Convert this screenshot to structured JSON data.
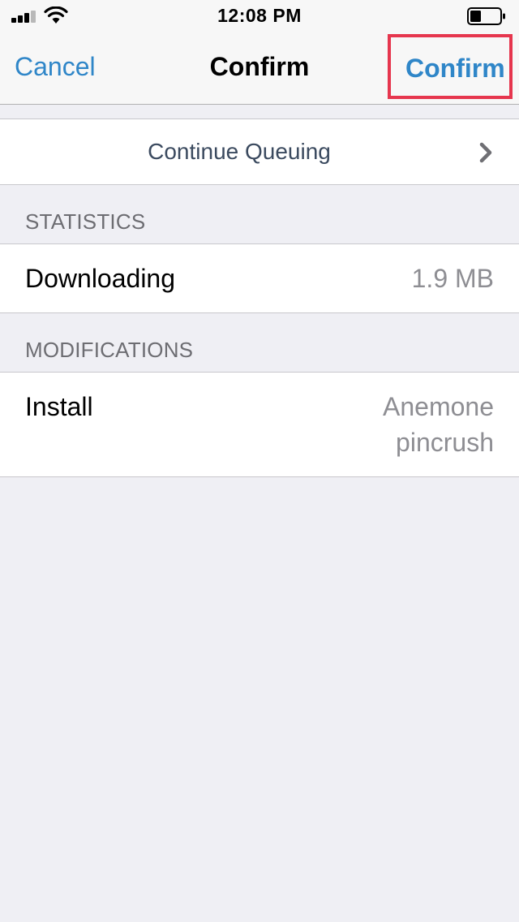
{
  "status_bar": {
    "time": "12:08 PM"
  },
  "nav": {
    "cancel_label": "Cancel",
    "title": "Confirm",
    "confirm_label": "Confirm",
    "accent_color": "#2f86c8",
    "highlight_color": "#e6364e"
  },
  "queue": {
    "label": "Continue Queuing",
    "icon": "chevron-right-icon"
  },
  "statistics": {
    "header": "STATISTICS",
    "row_label": "Downloading",
    "row_value": "1.9 MB"
  },
  "modifications": {
    "header": "MODIFICATIONS",
    "row_label": "Install",
    "value_line1": "Anemone",
    "value_line2": "pincrush"
  }
}
